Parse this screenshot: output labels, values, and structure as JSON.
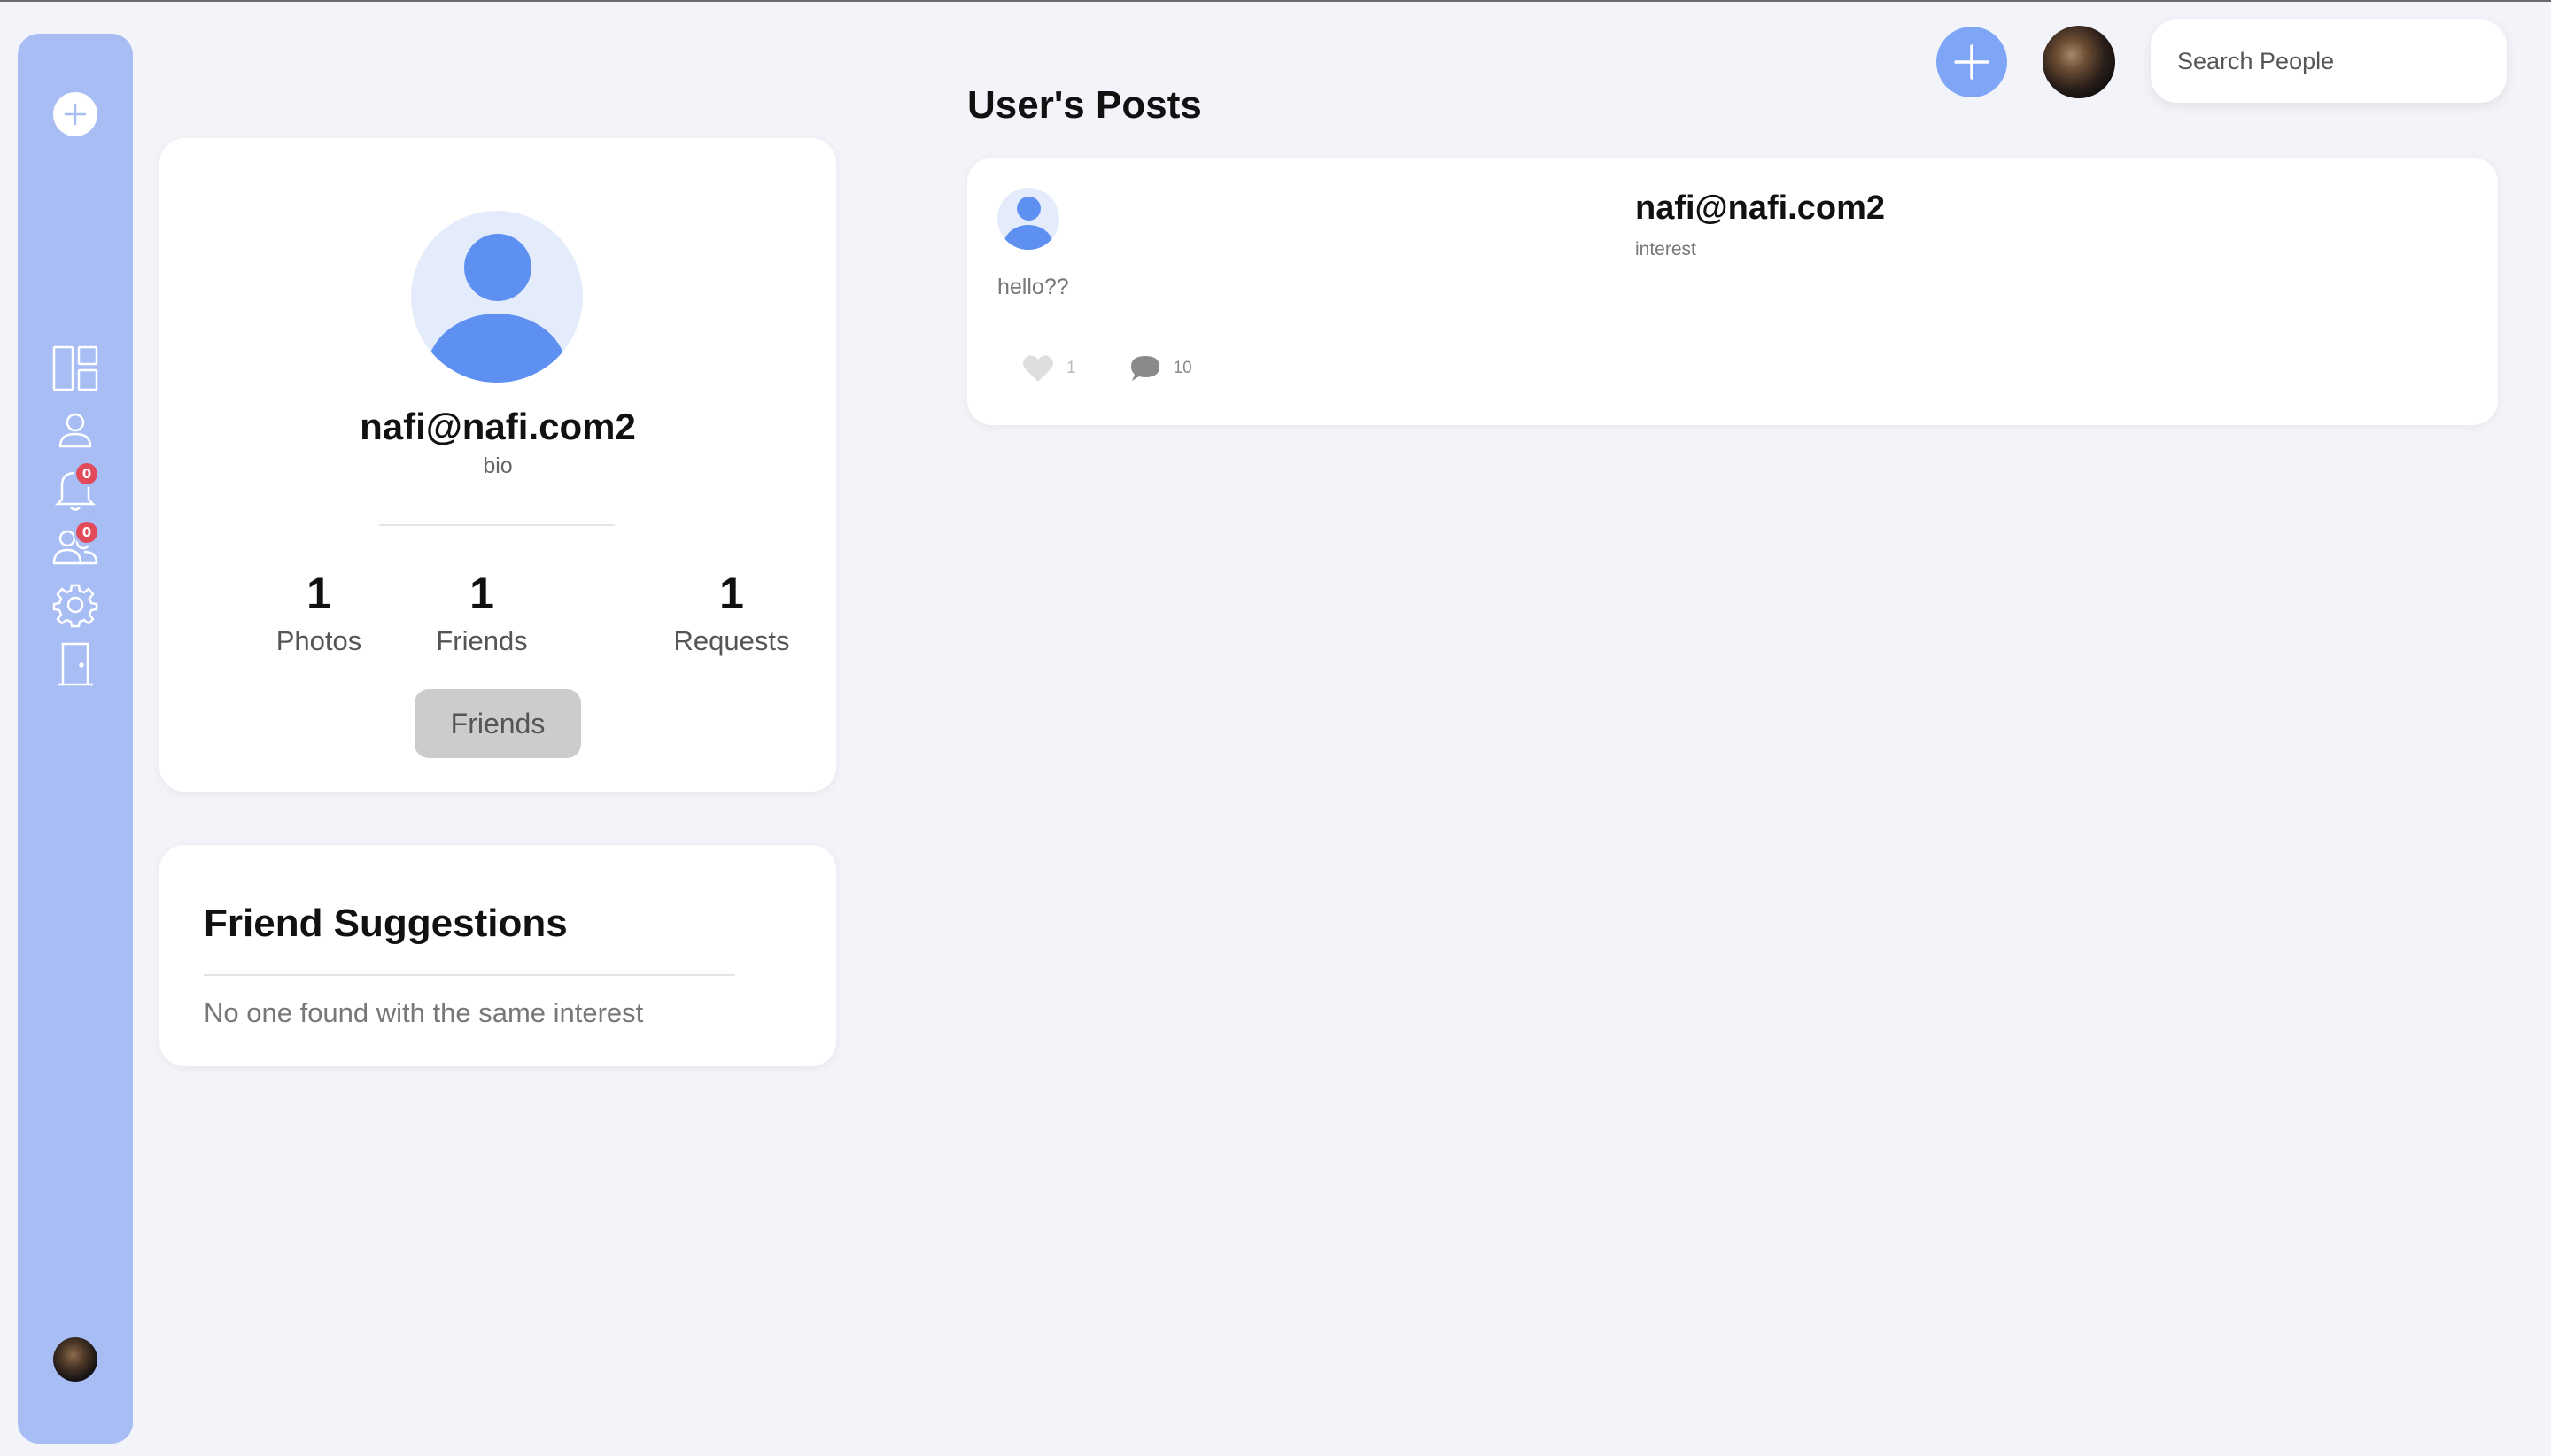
{
  "sidebar": {
    "badges": {
      "notifications": "0",
      "friend_requests": "0"
    }
  },
  "header": {
    "search": {
      "placeholder": "Search People",
      "value": ""
    }
  },
  "profile": {
    "name": "nafi@nafi.com2",
    "bio": "bio",
    "stats": [
      {
        "value": "1",
        "label": "Photos"
      },
      {
        "value": "1",
        "label": "Friends"
      },
      {
        "value": "1",
        "label": "Requests"
      }
    ],
    "friends_button": "Friends"
  },
  "suggestions": {
    "title": "Friend Suggestions",
    "empty_text": "No one found with the same interest"
  },
  "posts": {
    "title": "User's Posts",
    "items": [
      {
        "author": "nafi@nafi.com2",
        "interest": "interest",
        "text": "hello??",
        "likes": "1",
        "comments": "10"
      }
    ]
  },
  "colors": {
    "sidebar": "#a8bdf4",
    "accent": "#7ea5f6",
    "avatar_blue": "#5d90f1",
    "badge": "#e24a5a",
    "background": "#f3f4f9"
  },
  "icons": {
    "sidebar": [
      "plus-icon",
      "dashboard-icon",
      "user-icon",
      "bell-icon",
      "friends-icon",
      "gear-icon",
      "door-icon"
    ],
    "header": [
      "plus-icon",
      "search-icon"
    ],
    "post": [
      "heart-icon",
      "comment-icon"
    ]
  }
}
